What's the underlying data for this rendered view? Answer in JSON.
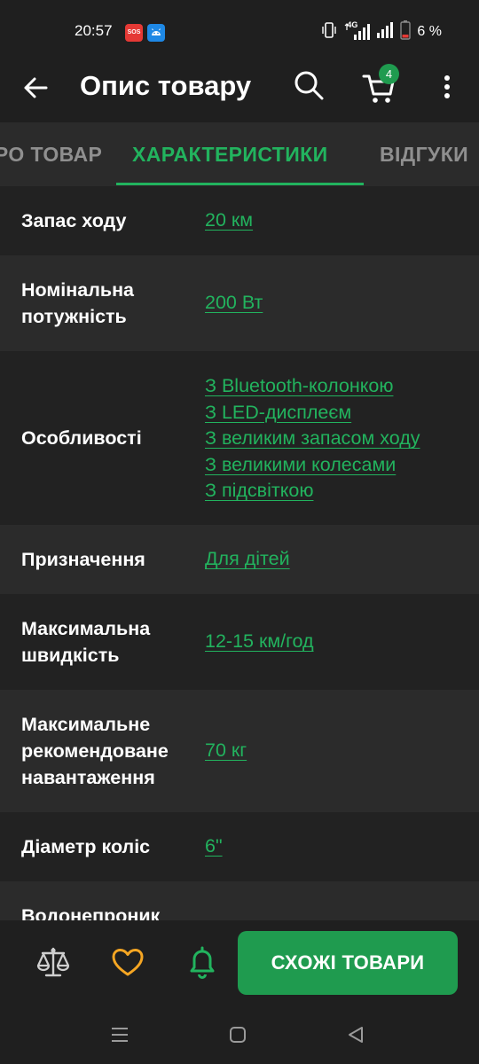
{
  "status_bar": {
    "time": "20:57",
    "sos_label": "SOS",
    "network_label": "4G",
    "battery_text": "6 %"
  },
  "app_bar": {
    "title": "Опис товару",
    "cart_count": "4"
  },
  "tabs": [
    {
      "label": "ПРО ТОВАР",
      "active": false
    },
    {
      "label": "ХАРАКТЕРИСТИКИ",
      "active": true
    },
    {
      "label": "ВІДГУКИ",
      "active": false
    }
  ],
  "specs": [
    {
      "label": "Запас ходу",
      "values": [
        "20 км"
      ]
    },
    {
      "label": "Номінальна потужність",
      "values": [
        "200 Вт"
      ]
    },
    {
      "label": "Особливості",
      "values": [
        "З Bluetooth-колонкою",
        "З LED-дисплеєм",
        "З великим запасом ходу",
        "З великими колесами",
        "З підсвіткою"
      ]
    },
    {
      "label": "Призначення",
      "values": [
        "Для дітей"
      ]
    },
    {
      "label": "Максимальна швидкість",
      "values": [
        "12-15 км/год"
      ]
    },
    {
      "label": "Максимальне рекомендоване навантаження",
      "values": [
        "70 кг"
      ]
    },
    {
      "label": "Діаметр коліс",
      "values": [
        "6\""
      ]
    },
    {
      "label": "Водонепроник",
      "values": []
    }
  ],
  "bottom_bar": {
    "similar_button": "СХОЖІ ТОВАРИ",
    "compare_icon": "scales-icon",
    "favorite_icon": "heart-icon",
    "notify_icon": "bell-icon"
  },
  "colors": {
    "accent": "#22b35e",
    "button": "#1f9b4f",
    "favorite": "#f5a623",
    "background": "#1f1f1f"
  }
}
